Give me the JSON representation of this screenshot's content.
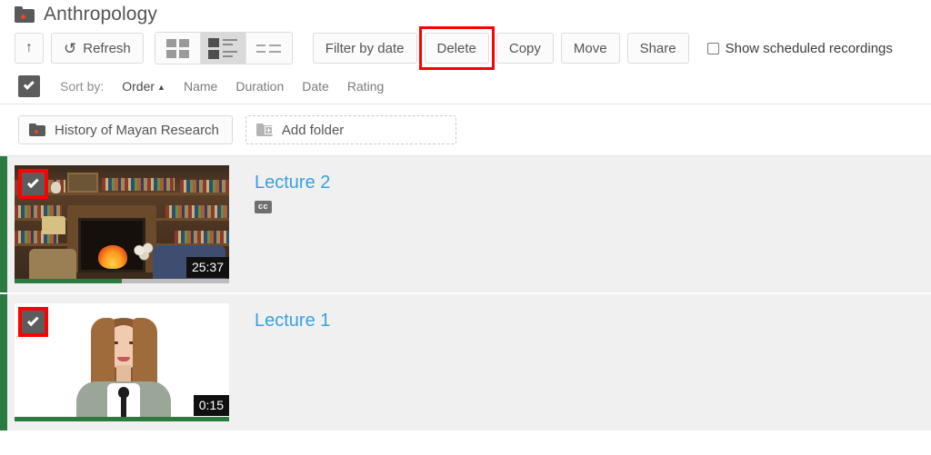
{
  "header": {
    "folder_icon": "folder-icon",
    "title": "Anthropology"
  },
  "toolbar": {
    "up_label": "↑",
    "refresh_label": "Refresh",
    "refresh_icon": "refresh-icon",
    "view_modes": [
      {
        "name": "grid-view",
        "active": false
      },
      {
        "name": "list-view",
        "active": true
      },
      {
        "name": "compact-view",
        "active": false
      }
    ],
    "filter_label": "Filter by date",
    "delete_label": "Delete",
    "copy_label": "Copy",
    "move_label": "Move",
    "share_label": "Share",
    "show_scheduled_label": "Show scheduled recordings",
    "show_scheduled_checked": false,
    "highlight_color": "#fe0000"
  },
  "sort": {
    "select_all_checked": true,
    "label": "Sort by:",
    "options": [
      {
        "label": "Order",
        "active": true,
        "caret": "▲"
      },
      {
        "label": "Name",
        "active": false,
        "caret": ""
      },
      {
        "label": "Duration",
        "active": false,
        "caret": ""
      },
      {
        "label": "Date",
        "active": false,
        "caret": ""
      },
      {
        "label": "Rating",
        "active": false,
        "caret": ""
      }
    ]
  },
  "folders": {
    "items": [
      {
        "label": "History of Mayan Research",
        "style": "solid"
      }
    ],
    "add_label": "Add folder"
  },
  "recordings": [
    {
      "title": "Lecture 2",
      "duration": "25:37",
      "progress_percent": 50,
      "selected": true,
      "highlighted": true,
      "scene": "library",
      "badges": [
        "cc"
      ]
    },
    {
      "title": "Lecture 1",
      "duration": "0:15",
      "progress_percent": 100,
      "selected": true,
      "highlighted": true,
      "scene": "portrait",
      "badges": []
    }
  ],
  "colors": {
    "accent_link": "#3aa0dd",
    "green_bar": "#2b7a3f",
    "row_bg": "#f0f0f0",
    "checkbox_fill": "#5c5c5c"
  }
}
